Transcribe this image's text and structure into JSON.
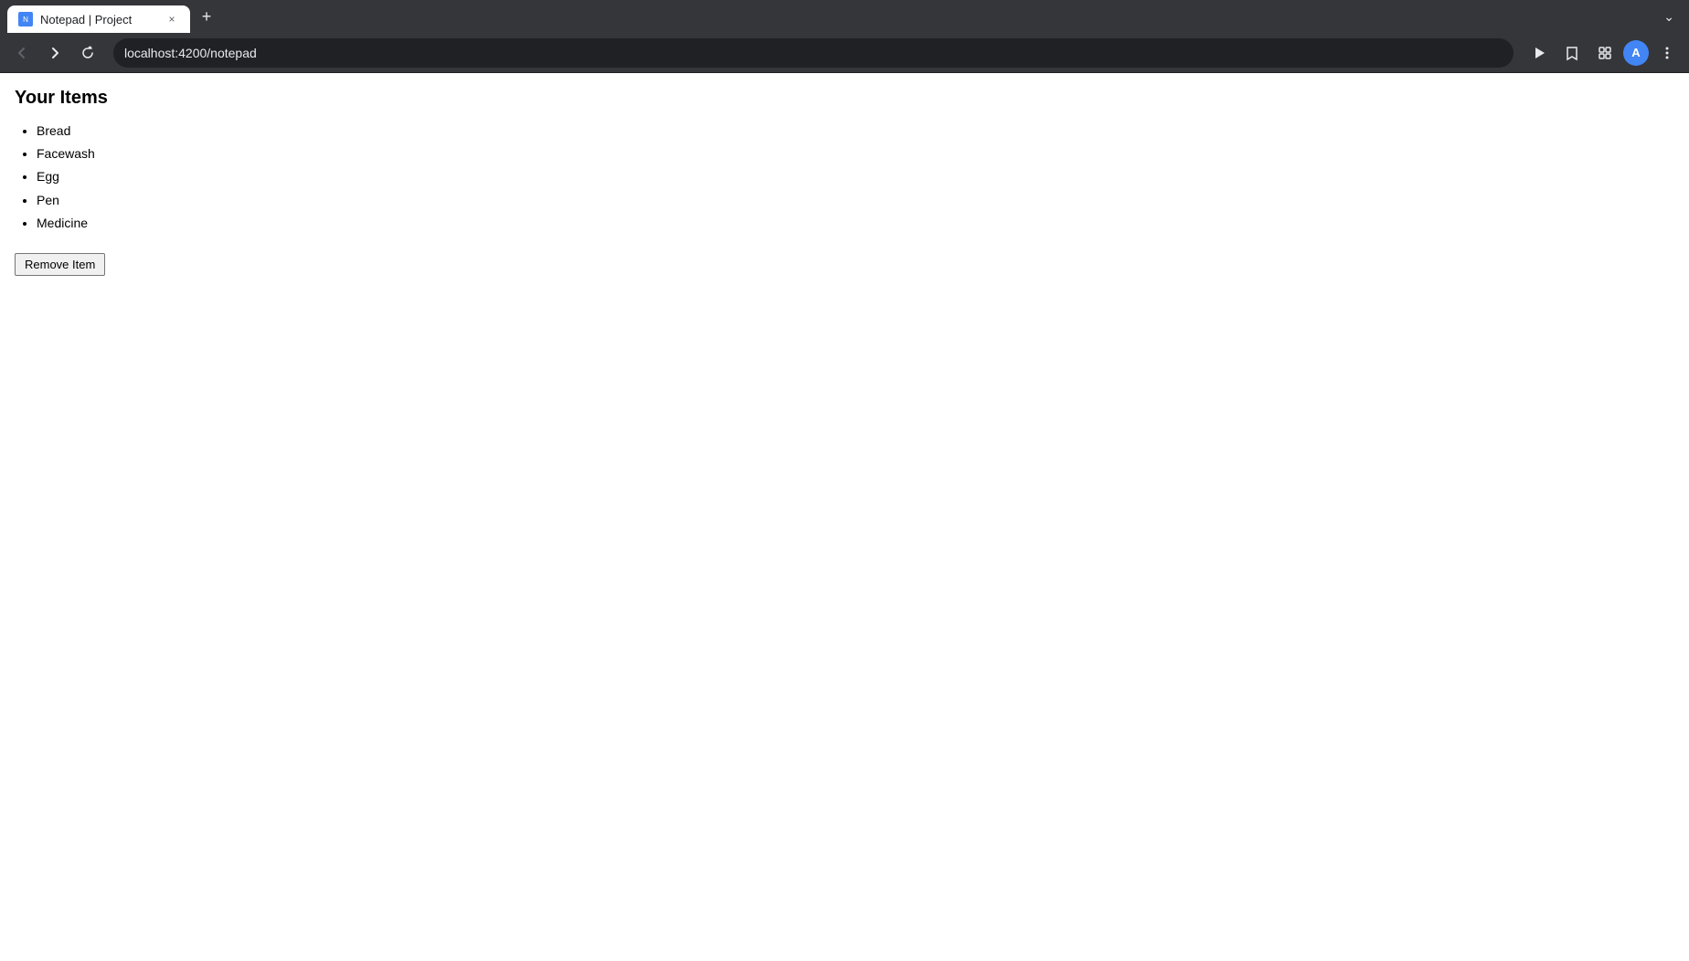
{
  "browser": {
    "tab": {
      "title": "Notepad | Project",
      "favicon_label": "N",
      "close_label": "×"
    },
    "new_tab_label": "+",
    "tab_bar_chevron": "⌄",
    "toolbar": {
      "back_label": "←",
      "forward_label": "→",
      "reload_label": "↻",
      "address": "localhost:4200/notepad",
      "cast_label": "⊡",
      "bookmark_label": "☆",
      "extensions_label": "⧉",
      "menu_label": "⋮",
      "profile_label": "A"
    }
  },
  "page": {
    "title": "Your Items",
    "items": [
      "Bread",
      "Facewash",
      "Egg",
      "Pen",
      "Medicine"
    ],
    "remove_button_label": "Remove Item"
  }
}
